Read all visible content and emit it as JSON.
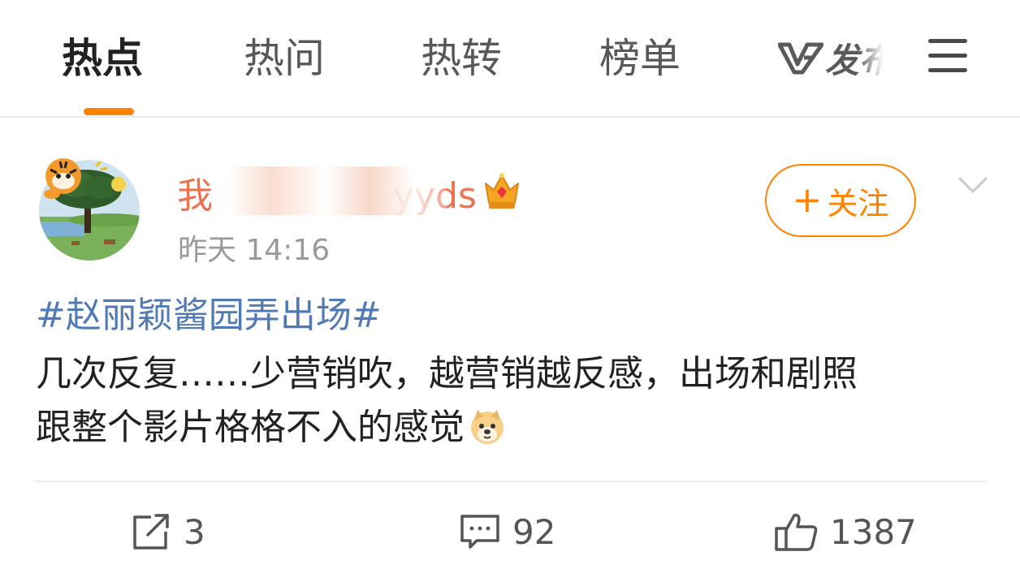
{
  "tabs": [
    {
      "label": "热点",
      "active": true
    },
    {
      "label": "热问",
      "active": false
    },
    {
      "label": "热转",
      "active": false
    },
    {
      "label": "榜单",
      "active": false
    }
  ],
  "publish": {
    "icon": "weibo-v-logo-icon",
    "label": "发布"
  },
  "menu": {
    "icon": "hamburger-menu-icon"
  },
  "post": {
    "username_prefix": "我",
    "username_suffix": "yyds",
    "username_obscured": true,
    "badge_icon": "crown-vip-icon",
    "time": "昨天 14:16",
    "follow_label": "关注",
    "follow_icon": "+",
    "hashtag": "#赵丽颖酱园弄出场#",
    "text_line1": "几次反复……少营销吹，越营销越反感，出场和剧照",
    "text_line2": "跟整个影片格格不入的感觉",
    "emoji": "doge-emoji"
  },
  "actions": {
    "repost": {
      "icon": "repost-icon",
      "count": "3"
    },
    "comment": {
      "icon": "comment-icon",
      "count": "92"
    },
    "like": {
      "icon": "thumbs-up-icon",
      "count": "1387"
    }
  },
  "colors": {
    "accent": "#ff8200",
    "username": "#eb7350",
    "hashtag": "#4f7ab6",
    "text": "#222222",
    "muted": "#9a9a9a"
  }
}
